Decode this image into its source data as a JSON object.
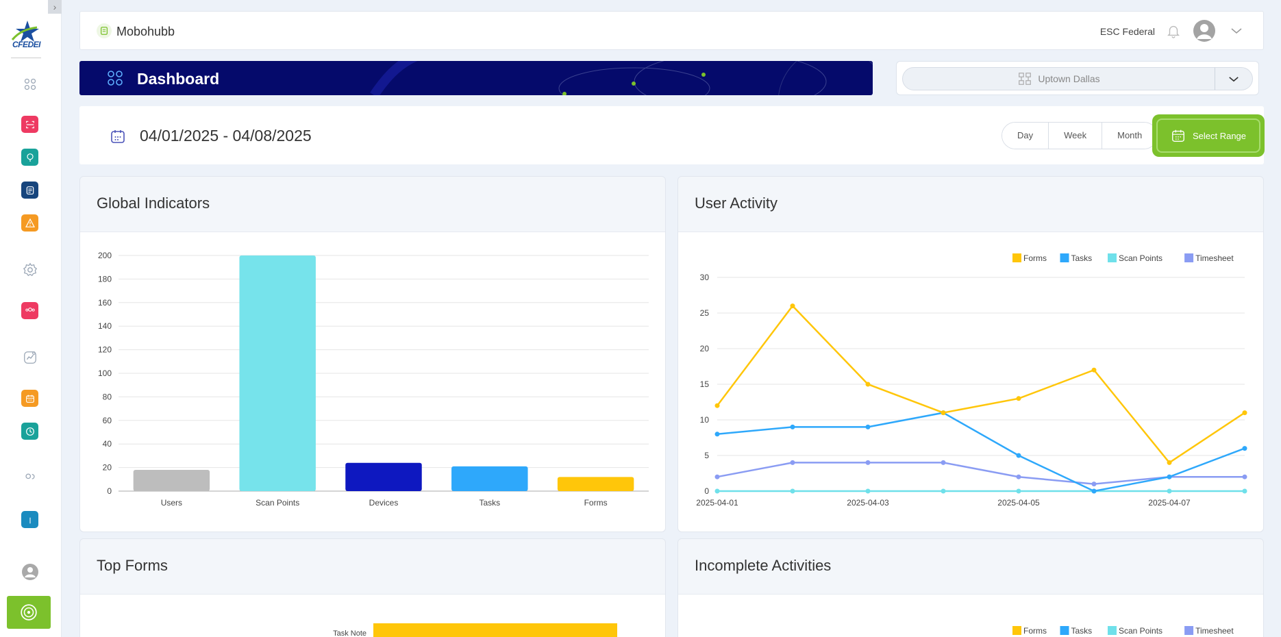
{
  "sidebar": {
    "logo_text": "CFEDEI",
    "items": [
      {
        "name": "dashboard",
        "icon": "grid-icon",
        "color": "#9aa6b5",
        "filled": false
      },
      {
        "name": "scan",
        "icon": "scan-icon",
        "color": "#ee3a62",
        "filled": true
      },
      {
        "name": "location",
        "icon": "pin-icon",
        "color": "#19a29a",
        "filled": true
      },
      {
        "name": "forms",
        "icon": "document-icon",
        "color": "#17457d",
        "filled": true
      },
      {
        "name": "alerts",
        "icon": "warning-icon",
        "color": "#f59a23",
        "filled": true
      },
      {
        "name": "settings",
        "icon": "gear-icon",
        "color": "#9aa6b5",
        "filled": false
      },
      {
        "name": "users-group",
        "icon": "users-group-icon",
        "color": "#ee3a62",
        "filled": true
      },
      {
        "name": "analytics",
        "icon": "analytics-icon",
        "color": "#9aa6b5",
        "filled": false
      },
      {
        "name": "calendar",
        "icon": "calendar-icon",
        "color": "#f59a23",
        "filled": true
      },
      {
        "name": "timesheet",
        "icon": "clock-icon",
        "color": "#19a29a",
        "filled": true
      },
      {
        "name": "contacts",
        "icon": "people-icon",
        "color": "#9aa6b5",
        "filled": false
      },
      {
        "name": "manual",
        "icon": "book-icon",
        "color": "#1a8bbf",
        "filled": true
      }
    ]
  },
  "header": {
    "brand": "Mobohubb",
    "org": "ESC Federal"
  },
  "banner": {
    "title": "Dashboard"
  },
  "location": {
    "selected": "Uptown Dallas"
  },
  "date_range": {
    "text": "04/01/2025 - 04/08/2025",
    "periods": [
      "Day",
      "Week",
      "Month"
    ],
    "select_label": "Select Range"
  },
  "cards": {
    "global_indicators": "Global Indicators",
    "user_activity": "User Activity",
    "top_forms": "Top Forms",
    "incomplete_activities": "Incomplete Activities"
  },
  "chart_data": [
    {
      "type": "bar",
      "title": "Global Indicators",
      "categories": [
        "Users",
        "Scan Points",
        "Devices",
        "Tasks",
        "Forms"
      ],
      "values": [
        18,
        200,
        24,
        21,
        12
      ],
      "colors": [
        "#bdbdbd",
        "#76e3eb",
        "#0e18c0",
        "#2ea8fb",
        "#ffc60a"
      ],
      "ylim": [
        0,
        200
      ],
      "yticks": [
        0,
        20,
        40,
        60,
        80,
        100,
        120,
        140,
        160,
        180,
        200
      ],
      "grid": true
    },
    {
      "type": "line",
      "title": "User Activity",
      "x": [
        "2025-04-01",
        "2025-04-02",
        "2025-04-03",
        "2025-04-04",
        "2025-04-05",
        "2025-04-06",
        "2025-04-07",
        "2025-04-08"
      ],
      "xtick_labels": [
        "2025-04-01",
        "2025-04-03",
        "2025-04-05",
        "2025-04-07"
      ],
      "series": [
        {
          "name": "Forms",
          "color": "#ffc60a",
          "values": [
            12,
            26,
            15,
            11,
            13,
            17,
            4,
            11
          ]
        },
        {
          "name": "Tasks",
          "color": "#2ea8fb",
          "values": [
            8,
            9,
            9,
            11,
            5,
            0,
            2,
            6
          ]
        },
        {
          "name": "Scan Points",
          "color": "#6fe0ea",
          "values": [
            0,
            0,
            0,
            0,
            0,
            0,
            0,
            0
          ]
        },
        {
          "name": "Timesheet",
          "color": "#8a9cf3",
          "values": [
            2,
            4,
            4,
            4,
            2,
            1,
            2,
            2
          ]
        }
      ],
      "ylim": [
        0,
        30
      ],
      "yticks": [
        0,
        5,
        10,
        15,
        20,
        25,
        30
      ],
      "legend": "top-right",
      "grid": true
    },
    {
      "type": "bar",
      "title": "Top Forms",
      "orientation": "horizontal",
      "categories": [
        "Task Note"
      ],
      "colors": [
        "#ffc60a"
      ]
    },
    {
      "type": "line",
      "title": "Incomplete Activities",
      "series": [
        {
          "name": "Forms",
          "color": "#ffc60a"
        },
        {
          "name": "Tasks",
          "color": "#2ea8fb"
        },
        {
          "name": "Scan Points",
          "color": "#6fe0ea"
        },
        {
          "name": "Timesheet",
          "color": "#8a9cf3"
        }
      ],
      "legend": "top-right"
    }
  ]
}
